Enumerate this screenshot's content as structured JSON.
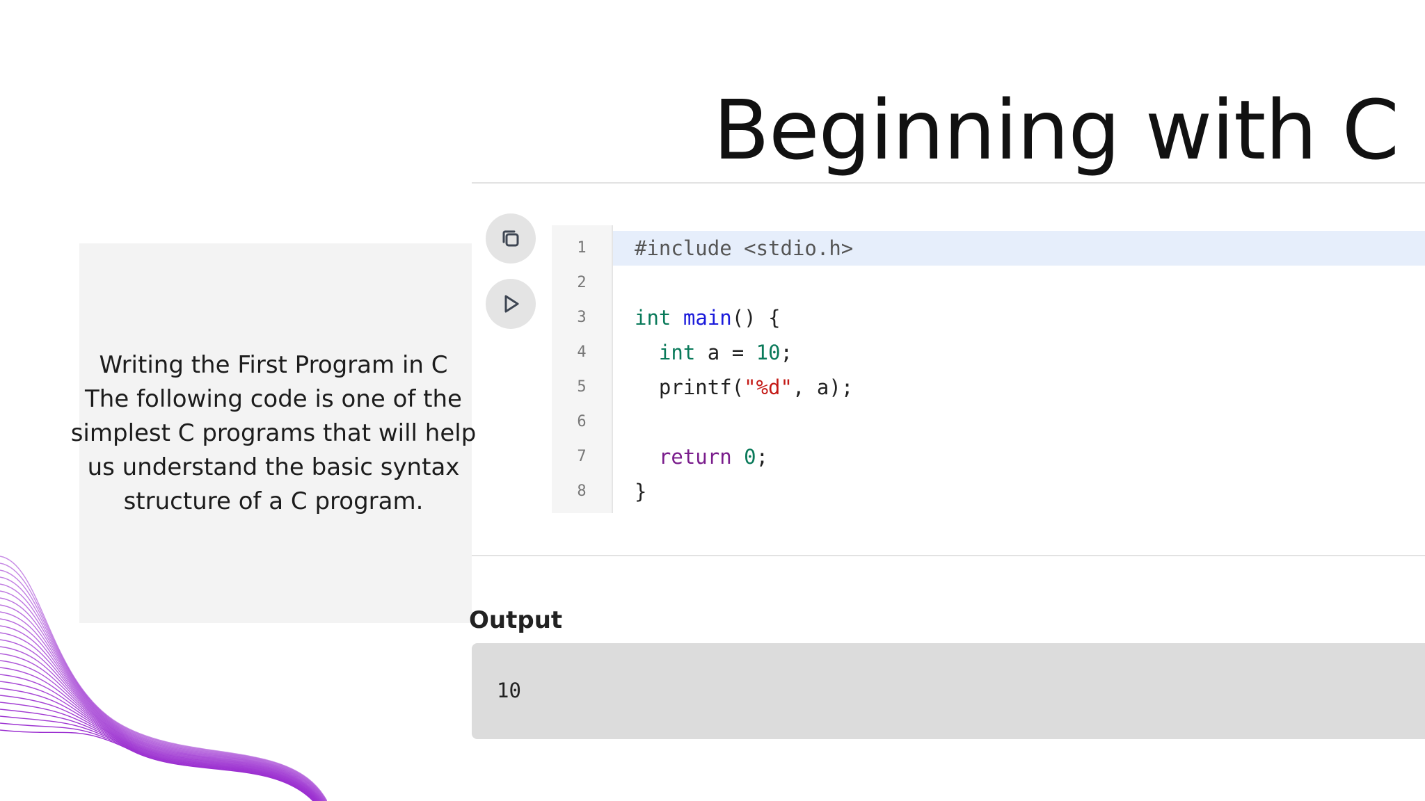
{
  "slide": {
    "title": "Beginning with C",
    "description_lines": [
      "Writing the First Program in C",
      "The following code is one of the",
      "simplest C programs that will help",
      "us understand the basic syntax",
      "structure of a C program."
    ]
  },
  "toolbar": {
    "copy_icon": "copy-icon",
    "run_icon": "play-icon"
  },
  "editor": {
    "active_line": 1,
    "line_numbers": [
      "1",
      "2",
      "3",
      "4",
      "5",
      "6",
      "7",
      "8"
    ],
    "lines": [
      [
        {
          "t": "#include <stdio.h>",
          "k": "pre"
        }
      ],
      [],
      [
        {
          "t": "int",
          "k": "type"
        },
        {
          "t": " ",
          "k": "ident"
        },
        {
          "t": "main",
          "k": "fn"
        },
        {
          "t": "() {",
          "k": "ident"
        }
      ],
      [
        {
          "t": "  ",
          "k": "ident"
        },
        {
          "t": "int",
          "k": "type"
        },
        {
          "t": " a = ",
          "k": "ident"
        },
        {
          "t": "10",
          "k": "num"
        },
        {
          "t": ";",
          "k": "ident"
        }
      ],
      [
        {
          "t": "  printf(",
          "k": "ident"
        },
        {
          "t": "\"%d\"",
          "k": "str"
        },
        {
          "t": ", a);",
          "k": "ident"
        }
      ],
      [],
      [
        {
          "t": "  ",
          "k": "ident"
        },
        {
          "t": "return",
          "k": "kw"
        },
        {
          "t": " ",
          "k": "ident"
        },
        {
          "t": "0",
          "k": "num"
        },
        {
          "t": ";",
          "k": "ident"
        }
      ],
      [
        {
          "t": "}",
          "k": "ident"
        }
      ]
    ]
  },
  "output": {
    "label": "Output",
    "value": "10"
  },
  "colors": {
    "keyword_type": "#0a7a5a",
    "function_name": "#1a1adb",
    "string": "#c41a16",
    "return_keyword": "#7a1d8c",
    "wave_accent": "#9b2fd0"
  }
}
